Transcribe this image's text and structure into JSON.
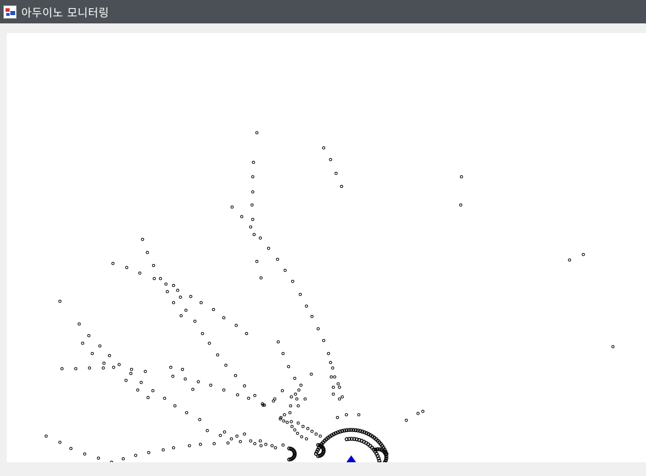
{
  "window": {
    "title": "아두이노 모니터링",
    "icon": "app-icon"
  },
  "plot": {
    "background": "#ffffff",
    "marker_stroke": "#000000",
    "origin_marker_color": "#0000cc"
  }
}
